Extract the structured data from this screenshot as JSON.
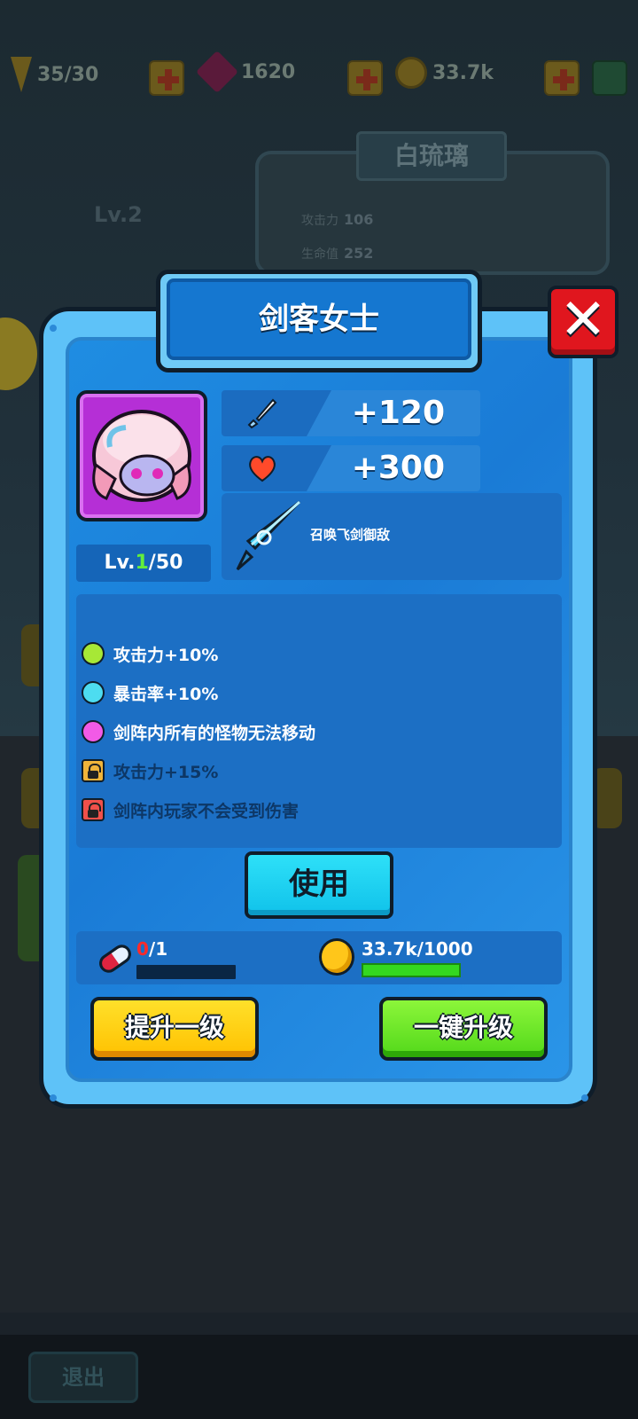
{
  "background": {
    "resources": [
      {
        "icon": "lightning-icon",
        "value": "35/30"
      },
      {
        "icon": "gem-icon",
        "value": "1620"
      },
      {
        "icon": "coin-icon",
        "value": "33.7k"
      }
    ],
    "hero_name": "白琉璃",
    "level": "Lv.2",
    "stats": [
      {
        "label": "攻击力",
        "value": "106"
      },
      {
        "label": "生命值",
        "value": "252"
      }
    ],
    "exit_label": "退出"
  },
  "dialog": {
    "title": "剑客女士",
    "close_icon": "close-icon",
    "level_prefix": "Lv.",
    "level_current": "1",
    "level_max": "/50",
    "stats": [
      {
        "icon": "sword-icon",
        "value": "+120"
      },
      {
        "icon": "heart-icon",
        "value": "+300"
      }
    ],
    "skill": {
      "icon": "crystal-sword-icon",
      "text": "召唤飞剑御敌"
    },
    "effects": [
      {
        "marker": "green-dot",
        "text": "攻击力+10%",
        "locked": false
      },
      {
        "marker": "cyan-dot",
        "text": "暴击率+10%",
        "locked": false
      },
      {
        "marker": "magenta-dot",
        "text": "剑阵内所有的怪物无法移动",
        "locked": false
      },
      {
        "marker": "gold-lock",
        "text": "攻击力+15%",
        "locked": true
      },
      {
        "marker": "red-lock",
        "text": "剑阵内玩家不会受到伤害",
        "locked": true
      }
    ],
    "use_button": "使用",
    "costs": {
      "fragment": {
        "icon": "pill-icon",
        "current": "0",
        "required": "/1",
        "progress": 0
      },
      "coin": {
        "icon": "coin-icon",
        "value": "33.7k/1000",
        "progress": 1
      }
    },
    "upgrade_one_button": "提升一级",
    "upgrade_all_button": "一键升级"
  },
  "colors": {
    "dialog_blue": "#1f8de2",
    "frame_light_blue": "#5ec2f8",
    "close_red": "#e0161e",
    "use_cyan": "#2ee0f8",
    "upgrade_yellow": "#ffc100",
    "upgrade_green": "#52d81a",
    "progress_green": "#34d820",
    "level_green": "#63ee3b"
  }
}
